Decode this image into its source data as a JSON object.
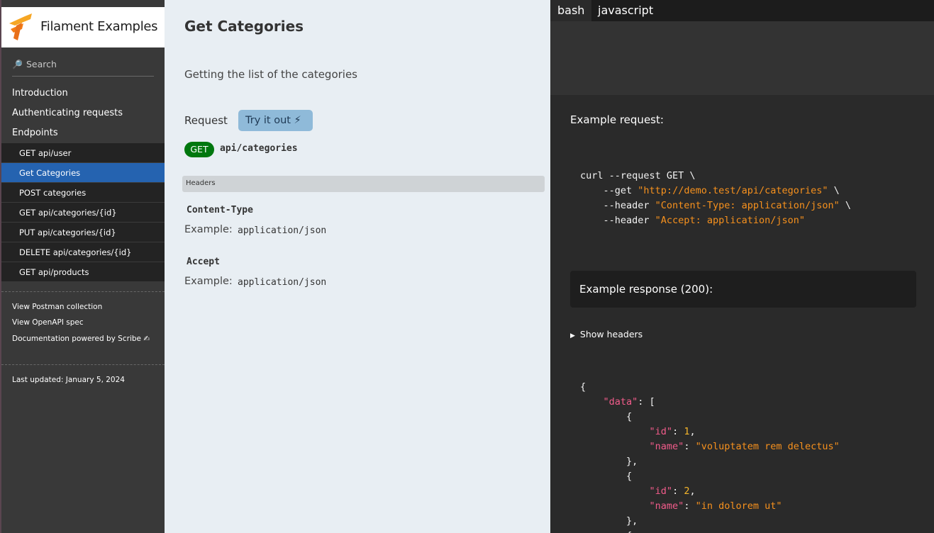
{
  "brand": {
    "name": "Filament Examples"
  },
  "search": {
    "placeholder": "Search",
    "icon": "search-icon"
  },
  "nav": {
    "top": [
      "Introduction",
      "Authenticating requests",
      "Endpoints"
    ],
    "endpoints": [
      "GET api/user",
      "Get Categories",
      "POST categories",
      "GET api/categories/{id}",
      "PUT api/categories/{id}",
      "DELETE api/categories/{id}",
      "GET api/products"
    ],
    "active_index": 1,
    "footer": [
      "View Postman collection",
      "View OpenAPI spec",
      "Documentation powered by Scribe ✍"
    ],
    "updated": "Last updated: January 5, 2024"
  },
  "content": {
    "title": "Get Categories",
    "description": "Getting the list of the categories",
    "request_label": "Request",
    "try_label": "Try it out ⚡",
    "method": "GET",
    "endpoint": "api/categories",
    "headers_title": "Headers",
    "headers": [
      {
        "name": "Content-Type",
        "example_label": "Example:",
        "example": "application/json"
      },
      {
        "name": "Accept",
        "example_label": "Example:",
        "example": "application/json"
      }
    ]
  },
  "code": {
    "tabs": [
      "bash",
      "javascript"
    ],
    "active_tab": "bash",
    "example_request_label": "Example request:",
    "curl": {
      "line1": "curl --request GET \\",
      "get_flag": "--get ",
      "url": "\"http://demo.test/api/categories\"",
      "header_flag": "--header ",
      "header1": "\"Content-Type: application/json\"",
      "header2": "\"Accept: application/json\"",
      "continuation": " \\"
    },
    "example_response_label": "Example response (200):",
    "show_headers_label": "Show headers",
    "response": {
      "data_key": "\"data\"",
      "id_key": "\"id\"",
      "name_key": "\"name\"",
      "items": [
        {
          "id": "1",
          "name": "\"voluptatem rem delectus\""
        },
        {
          "id": "2",
          "name": "\"in dolorem ut\""
        }
      ]
    }
  },
  "colors": {
    "active_nav": "#2563b0",
    "get_badge": "#00770e",
    "try_button": "#8fbad9",
    "code_string": "#f7911d",
    "code_key": "#f25c8b",
    "code_number": "#f7b72a"
  }
}
